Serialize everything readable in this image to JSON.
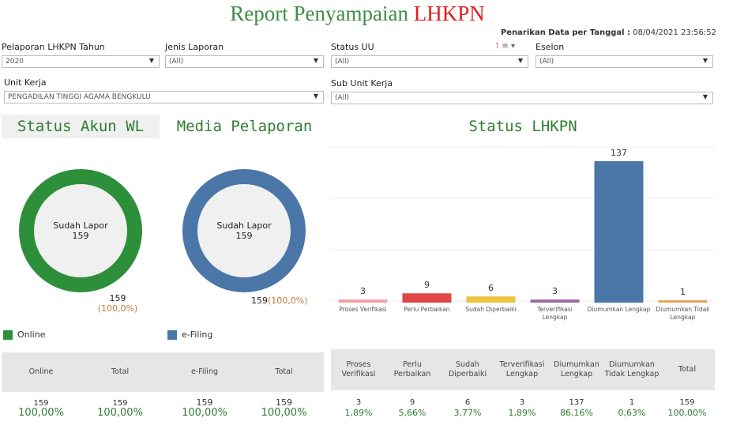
{
  "header": {
    "title_part1": "Report Penyampaian",
    "title_part2": "LHKPN",
    "date_label": "Penarikan Data per Tanggal :",
    "date_value": "08/04/2021 23:56:52"
  },
  "filters": {
    "tahun": {
      "label": "Pelaporan LHKPN Tahun",
      "value": "2020"
    },
    "jenis": {
      "label": "Jenis Laporan",
      "value": "(All)"
    },
    "status_uu": {
      "label": "Status UU",
      "value": "(All)"
    },
    "eselon": {
      "label": "Eselon",
      "value": "(All)"
    },
    "unit": {
      "label": "Unit Kerja",
      "value": "PENGADILAN TINGGI AGAMA BENGKULU"
    },
    "sub_unit": {
      "label": "Sub Unit Kerja",
      "value": "(All)"
    }
  },
  "status_akun": {
    "title": "Status Akun WL",
    "center_label": "Sudah Lapor",
    "center_value": "159",
    "total": "159",
    "pct": "(100,0%)",
    "color": "#2e8f3a",
    "legend": "Online",
    "table": {
      "headers": [
        "Online",
        "Total"
      ],
      "counts": [
        "159",
        "159"
      ],
      "percents": [
        "100,00%",
        "100,00%"
      ]
    }
  },
  "media": {
    "title": "Media Pelaporan",
    "center_label": "Sudah Lapor",
    "center_value": "159",
    "total": "159",
    "pct": "(100,0%)",
    "color": "#4a76a8",
    "legend": "e-Filing",
    "table": {
      "headers": [
        "e-Filing",
        "Total"
      ],
      "counts": [
        "159",
        "159"
      ],
      "percents": [
        "100,00%",
        "100,00%"
      ]
    }
  },
  "lhkpn": {
    "title": "Status LHKPN",
    "table": {
      "headers": [
        "Proses Verifikasi",
        "Perlu Perbaikan",
        "Sudah Diperbaiki",
        "Terverifikasi Lengkap",
        "Diumumkan Lengkap",
        "Diumumkan Tidak Lengkap",
        "Total"
      ],
      "counts": [
        "3",
        "9",
        "6",
        "3",
        "137",
        "1",
        "159"
      ],
      "percents": [
        "1,89%",
        "5,66%",
        "3,77%",
        "1,89%",
        "86,16%",
        "0,63%",
        "100,00%"
      ]
    }
  },
  "chart_data": {
    "type": "bar",
    "categories": [
      [
        "Proses Verifikasi"
      ],
      [
        "Perlu Perbaikan"
      ],
      [
        "Sudah Diperbaiki"
      ],
      [
        "Terverifikasi",
        "Lengkap"
      ],
      [
        "Diumumkan Lengkap"
      ],
      [
        "Diumumkan Tidak",
        "Lengkap"
      ]
    ],
    "values": [
      3,
      9,
      6,
      3,
      137,
      1
    ],
    "colors": [
      "#f4a0a5",
      "#e04848",
      "#ecc440",
      "#9d6aa3",
      "#4a76a8",
      "#e8a35c"
    ],
    "ylim": [
      0,
      137
    ],
    "grid": true,
    "title": "Status LHKPN"
  }
}
